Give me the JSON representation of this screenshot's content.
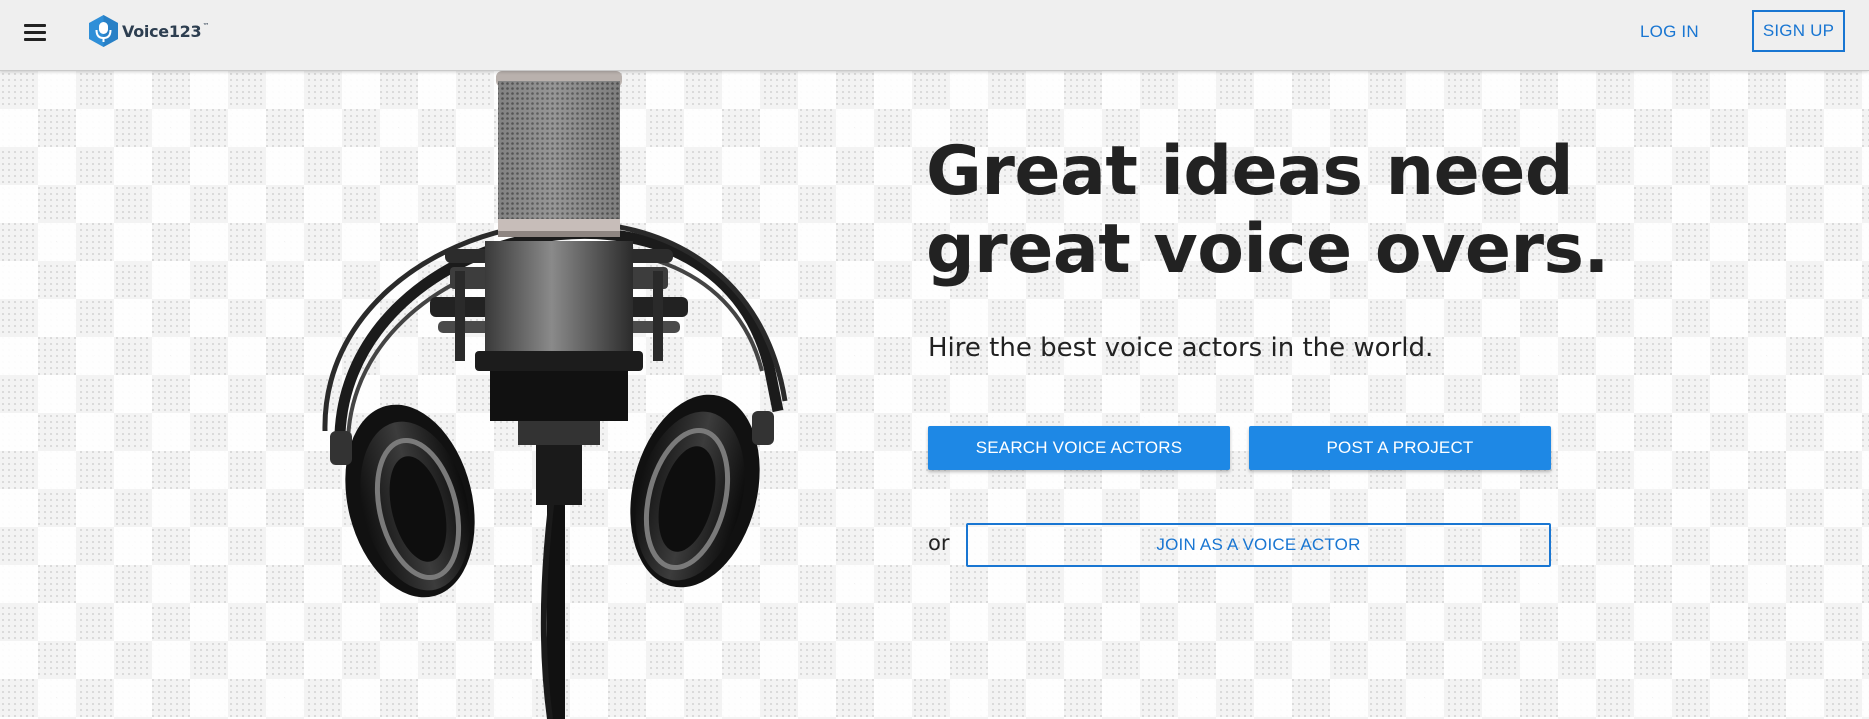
{
  "header": {
    "brand": {
      "name": "Voice123",
      "trademark": "™"
    },
    "login_label": "LOG IN",
    "signup_label": "SIGN UP"
  },
  "hero": {
    "headline_line1": "Great ideas need",
    "headline_line2": "great voice overs.",
    "subheadline": "Hire the best voice actors in the world.",
    "search_button_label": "SEARCH VOICE ACTORS",
    "post_button_label": "POST A PROJECT",
    "or_label": "or",
    "join_button_label": "JOIN AS A VOICE ACTOR"
  },
  "colors": {
    "accent": "#1e88e5",
    "link": "#1976d2",
    "header_bg": "#efefef",
    "text_dark": "#222222",
    "logo_blue": "#2f8fd8"
  },
  "icons": {
    "menu": "hamburger-menu-icon",
    "logo": "microphone-hexagon-logo"
  }
}
